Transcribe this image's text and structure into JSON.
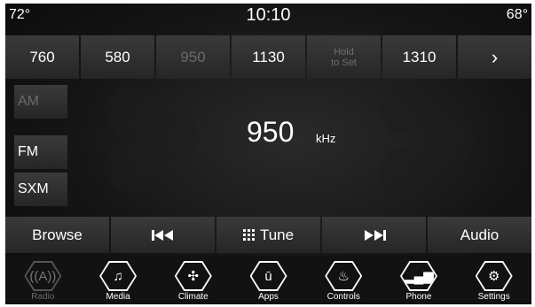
{
  "status": {
    "temp_left": "72°",
    "time": "10:10",
    "temp_right": "68°"
  },
  "presets": [
    {
      "label": "760"
    },
    {
      "label": "580"
    },
    {
      "label": "950"
    },
    {
      "label": "1130"
    },
    {
      "label": "Hold\nto Set"
    },
    {
      "label": "1310"
    },
    {
      "label": "›"
    }
  ],
  "bands": [
    {
      "label": "AM"
    },
    {
      "label": "FM"
    },
    {
      "label": "SXM"
    }
  ],
  "tuner": {
    "frequency": "950",
    "unit": "kHz"
  },
  "controls": {
    "browse": "Browse",
    "prev_icon": "skip-back-icon",
    "tune": "Tune",
    "next_icon": "skip-forward-icon",
    "audio": "Audio"
  },
  "nav": [
    {
      "label": "Radio",
      "icon": "radio-icon"
    },
    {
      "label": "Media",
      "icon": "music-note-icon"
    },
    {
      "label": "Climate",
      "icon": "climate-fan-icon"
    },
    {
      "label": "Apps",
      "icon": "apps-icon"
    },
    {
      "label": "Controls",
      "icon": "seat-controls-icon"
    },
    {
      "label": "Phone",
      "icon": "phone-signal-icon"
    },
    {
      "label": "Settings",
      "icon": "gear-icon"
    }
  ]
}
